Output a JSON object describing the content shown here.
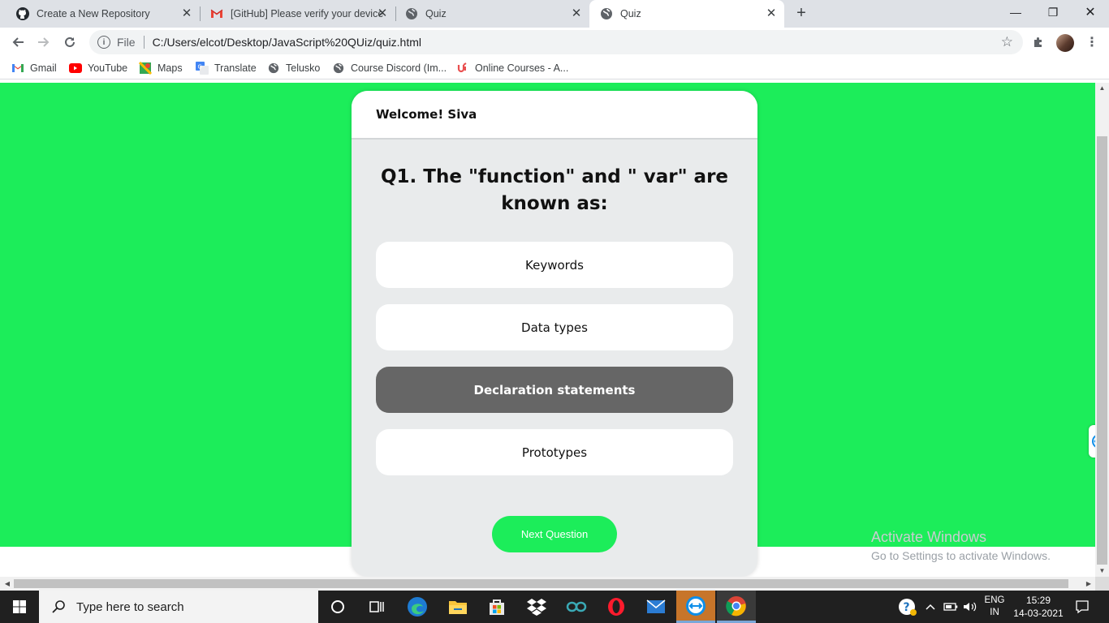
{
  "browser": {
    "tabs": [
      {
        "title": "Create a New Repository",
        "icon": "github-icon"
      },
      {
        "title": "[GitHub] Please verify your device",
        "icon": "gmail-icon"
      },
      {
        "title": "Quiz",
        "icon": "globe-icon"
      },
      {
        "title": "Quiz",
        "icon": "globe-icon",
        "active": true
      }
    ],
    "new_tab": "+",
    "window_controls": {
      "minimize": "—",
      "restore": "❐",
      "close": "✕"
    },
    "address": {
      "scheme_label": "File",
      "url": "C:/Users/elcot/Desktop/JavaScript%20QUiz/quiz.html"
    },
    "bookmarks": [
      {
        "label": "Gmail",
        "icon": "gmail-icon"
      },
      {
        "label": "YouTube",
        "icon": "youtube-icon"
      },
      {
        "label": "Maps",
        "icon": "maps-icon"
      },
      {
        "label": "Translate",
        "icon": "translate-icon"
      },
      {
        "label": "Telusko",
        "icon": "globe-icon"
      },
      {
        "label": "Course Discord (Im...",
        "icon": "globe-icon"
      },
      {
        "label": "Online Courses - A...",
        "icon": "udemy-icon"
      }
    ]
  },
  "quiz": {
    "welcome": "Welcome! Siva",
    "question": "Q1. The \"function\" and \" var\" are known as:",
    "options": [
      {
        "label": "Keywords",
        "selected": false
      },
      {
        "label": "Data types",
        "selected": false
      },
      {
        "label": "Declaration statements",
        "selected": true
      },
      {
        "label": "Prototypes",
        "selected": false
      }
    ],
    "next_label": "Next Question"
  },
  "watermark": {
    "line1": "Activate Windows",
    "line2": "Go to Settings to activate Windows."
  },
  "taskbar": {
    "search_placeholder": "Type here to search",
    "tray": {
      "lang": "ENG",
      "region": "IN",
      "time": "15:29",
      "date": "14-03-2021"
    }
  },
  "colors": {
    "page_background": "#1ced5a",
    "next_button": "#1ced5a",
    "selected_option": "#666666",
    "card": "#e9ebec"
  }
}
